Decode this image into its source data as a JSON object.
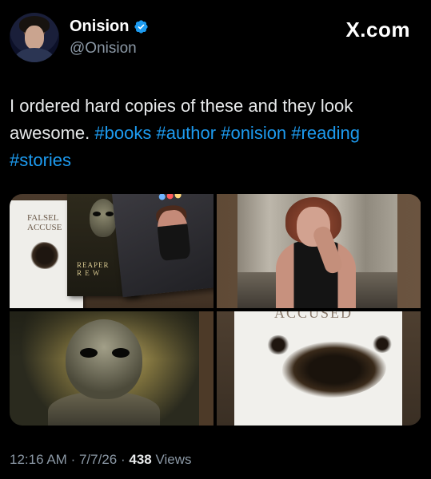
{
  "author": {
    "display_name": "Onision",
    "handle": "@Onision",
    "avatar_icon": "profile-avatar",
    "verified_icon": "verified-badge-icon"
  },
  "brand": {
    "label": "X.com"
  },
  "tweet": {
    "text_plain": "I ordered hard copies of these and they look awesome. ",
    "hashtags": [
      "#books",
      "#author",
      "#onision",
      "#reading",
      "#stories"
    ]
  },
  "media": {
    "tile1_book1_title": "FALSEL\nACCUSE",
    "tile1_book2_title": "REAPER\nR E W",
    "tile4_cover_title": "ACCUSED"
  },
  "meta": {
    "time": "12:16 AM",
    "date": "7/7/26",
    "separator": "·",
    "views_count": "438",
    "views_label": "Views"
  },
  "colors": {
    "background": "#000000",
    "link": "#1d9bf0",
    "secondary_text": "#8b98a5",
    "verified": "#1d9bf0"
  }
}
